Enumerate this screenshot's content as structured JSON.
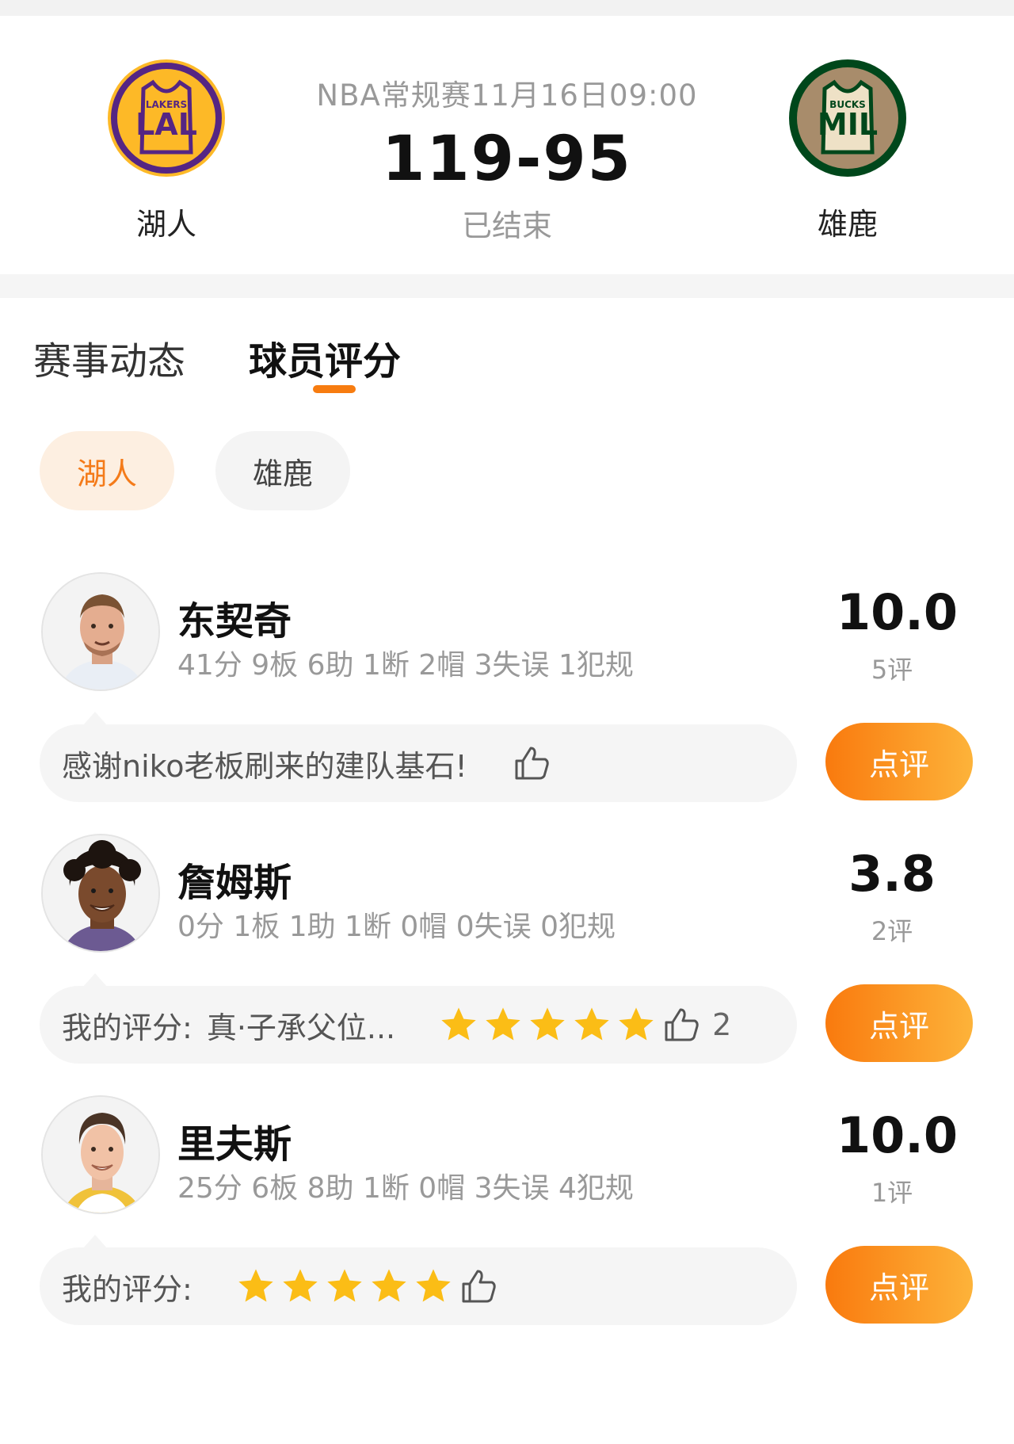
{
  "match": {
    "meta": "NBA常规赛11月16日09:00",
    "score": "119-95",
    "status": "已结束",
    "home_team": {
      "name": "湖人",
      "logo_text_small": "LAKERS",
      "logo_text_big": "LAL"
    },
    "away_team": {
      "name": "雄鹿",
      "logo_text_small": "BUCKS",
      "logo_text_big": "MIL"
    }
  },
  "tabs": [
    {
      "label": "赛事动态",
      "active": false
    },
    {
      "label": "球员评分",
      "active": true
    }
  ],
  "team_filters": [
    {
      "label": "湖人",
      "active": true
    },
    {
      "label": "雄鹿",
      "active": false
    }
  ],
  "players": [
    {
      "name": "东契奇",
      "stats": "41分 9板 6助 1断 2帽 3失误 1犯规",
      "score": "10.0",
      "rating_count": "5评",
      "comment": "感谢niko老板刷来的建队基石!",
      "review_button": "点评"
    },
    {
      "name": "詹姆斯",
      "stats": "0分 1板 1助 1断 0帽 0失误 0犯规",
      "score": "3.8",
      "rating_count": "2评",
      "my_rating_label": "我的评分:",
      "my_comment": "真·子承父位...",
      "my_stars": 5,
      "likes": "2",
      "review_button": "点评"
    },
    {
      "name": "里夫斯",
      "stats": "25分 6板 8助 1断 0帽 3失误 4犯规",
      "score": "10.0",
      "rating_count": "1评",
      "my_rating_label": "我的评分:",
      "my_stars": 5,
      "review_button": "点评"
    }
  ],
  "colors": {
    "accent": "#f77c10",
    "button_gradient_start": "#f97a0e",
    "button_gradient_end": "#fdb33a",
    "star": "#fbbd16",
    "lakers_purple": "#552583",
    "lakers_gold": "#fdb927",
    "bucks_green": "#00471b",
    "bucks_cream": "#eee1c6"
  }
}
